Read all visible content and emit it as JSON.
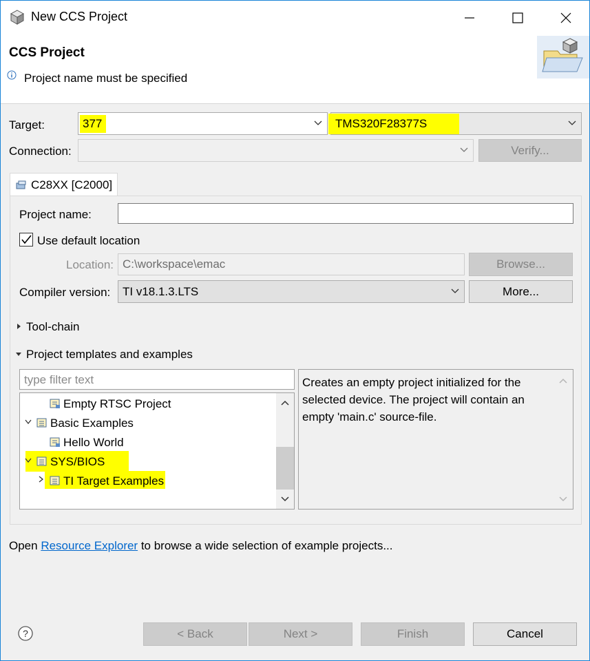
{
  "window": {
    "title": "New CCS Project",
    "icon": "cube-icon"
  },
  "header": {
    "title": "CCS Project",
    "message": "Project name must be specified"
  },
  "target": {
    "label": "Target:",
    "filter_value": "377",
    "device_value": "TMS320F28377S"
  },
  "connection": {
    "label": "Connection:",
    "value": "",
    "verify_label": "Verify..."
  },
  "tab": {
    "label": "C28XX [C2000]"
  },
  "project": {
    "name_label": "Project name:",
    "name_value": "",
    "use_default_label": "Use default location",
    "use_default_checked": true,
    "location_label": "Location:",
    "location_value": "C:\\workspace\\emac",
    "browse_label": "Browse...",
    "compiler_label": "Compiler version:",
    "compiler_value": "TI v18.1.3.LTS",
    "more_label": "More..."
  },
  "sections": {
    "toolchain": "Tool-chain",
    "templates": "Project templates and examples"
  },
  "templates": {
    "filter_placeholder": "type filter text",
    "tree": [
      {
        "label": "Empty RTSC Project",
        "expanded": null
      },
      {
        "label": "Basic Examples",
        "expanded": true
      },
      {
        "label": "Hello World",
        "expanded": null
      },
      {
        "label": "SYS/BIOS",
        "expanded": true,
        "highlighted": true
      },
      {
        "label": "TI Target Examples",
        "expanded": false,
        "highlighted": true
      }
    ],
    "description": "Creates an empty project initialized for the selected device. The project will contain an empty 'main.c' source-file."
  },
  "footer": {
    "prefix": "Open ",
    "link": "Resource Explorer",
    "suffix": " to browse a wide selection of example projects..."
  },
  "buttons": {
    "help_icon": "help-icon",
    "back": "< Back",
    "next": "Next >",
    "finish": "Finish",
    "cancel": "Cancel"
  },
  "colors": {
    "highlight": "#ffff00",
    "accent": "#1883d7",
    "link": "#0066cc"
  }
}
